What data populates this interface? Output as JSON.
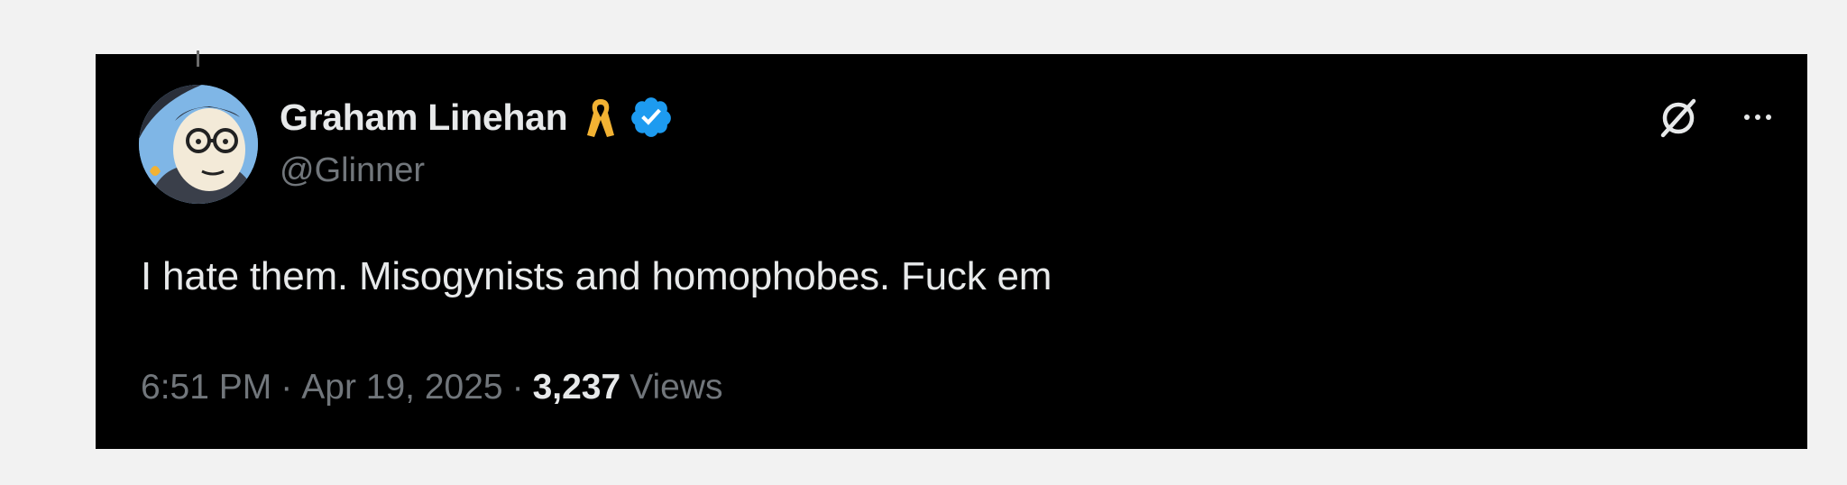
{
  "tweet": {
    "display_name": "Graham Linehan",
    "handle": "@Glinner",
    "text": "I hate them. Misogynists and homophobes. Fuck em",
    "time": "6:51 PM",
    "separator": "·",
    "date": "Apr 19, 2025",
    "views_count": "3,237",
    "views_label": "Views"
  },
  "icons": {
    "avatar": "avatar-illustration",
    "ribbon": "awareness-ribbon-icon",
    "verified": "verified-badge-icon",
    "grok": "grok-icon",
    "more": "more-options-icon"
  },
  "colors": {
    "card_background": "#000000",
    "page_background": "#f2f2f2",
    "primary_text": "#e7e9ea",
    "secondary_text": "#71767b",
    "verified_blue": "#1d9bf0",
    "ribbon_gold": "#f2b233"
  }
}
